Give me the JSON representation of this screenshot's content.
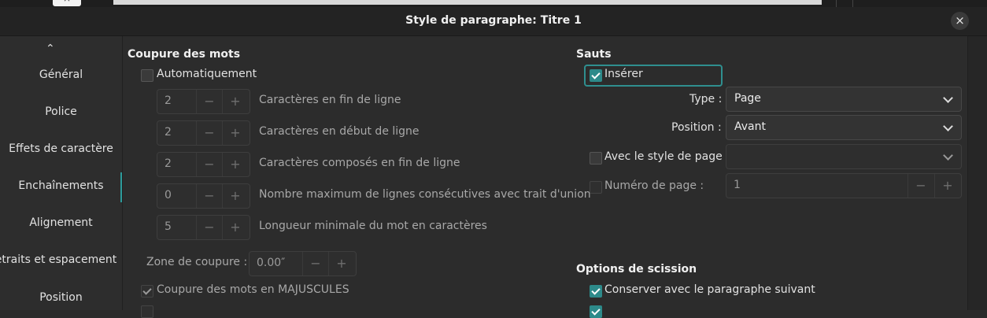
{
  "window": {
    "title": "Style de paragraphe: Titre 1",
    "close_glyph": "×",
    "bg_close_glyph": "×"
  },
  "sidebar": {
    "scroll_up_glyph": "⌃",
    "items": [
      {
        "label": "Général"
      },
      {
        "label": "Police"
      },
      {
        "label": "Effets de caractère"
      },
      {
        "label": "Enchaînements",
        "active": true
      },
      {
        "label": "Alignement"
      },
      {
        "label": "etraits et espacement"
      },
      {
        "label": "Position"
      }
    ]
  },
  "hyphenation": {
    "title": "Coupure des mots",
    "automatic": {
      "label": "Automatiquement",
      "checked": false
    },
    "fields": [
      {
        "value": "2",
        "label": "Caractères en fin de ligne"
      },
      {
        "value": "2",
        "label": "Caractères en début de ligne"
      },
      {
        "value": "2",
        "label": "Caractères composés en fin de ligne"
      },
      {
        "value": "0",
        "label": "Nombre maximum de lignes consécutives avec trait d'union"
      },
      {
        "value": "5",
        "label": "Longueur minimale du mot en caractères"
      }
    ],
    "zone": {
      "label": "Zone de coupure :",
      "value": "0.00″"
    },
    "uppercase": {
      "label": "Coupure des mots en MAJUSCULES",
      "checked": true
    }
  },
  "breaks": {
    "title": "Sauts",
    "insert": {
      "label": "Insérer",
      "checked": true
    },
    "type": {
      "label": "Type :",
      "value": "Page"
    },
    "position": {
      "label": "Position :",
      "value": "Avant"
    },
    "page_style": {
      "label": "Avec le style de page :",
      "value": "",
      "checked": false
    },
    "page_number": {
      "label": "Numéro de page :",
      "value": "1",
      "checked": false
    }
  },
  "split": {
    "title": "Options de scission",
    "keep_next": {
      "label": "Conserver avec le paragraphe suivant",
      "checked": true
    }
  },
  "spin_glyphs": {
    "minus": "−",
    "plus": "+"
  },
  "colors": {
    "accent": "#2d8a8a",
    "background": "#2a2a2a"
  }
}
